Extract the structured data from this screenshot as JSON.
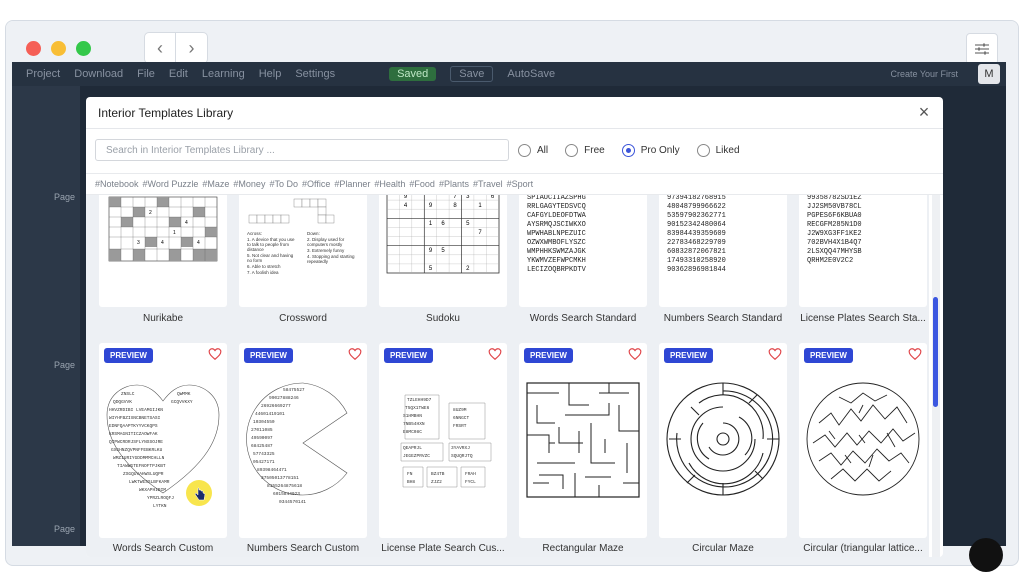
{
  "app_menu": {
    "items": [
      "Project",
      "Download",
      "File",
      "Edit",
      "Learning",
      "Help",
      "Settings"
    ],
    "saved_label": "Saved",
    "save_label": "Save",
    "autosave_label": "AutoSave",
    "create_hint": "Create Your First",
    "avatar_letter": "M"
  },
  "side": {
    "page_label": "Page"
  },
  "modal": {
    "title": "Interior Templates Library",
    "search_placeholder": "Search in Interior Templates Library ...",
    "filters": [
      {
        "label": "All",
        "selected": false
      },
      {
        "label": "Free",
        "selected": false
      },
      {
        "label": "Pro Only",
        "selected": true
      },
      {
        "label": "Liked",
        "selected": false
      }
    ],
    "tags": [
      "#Notebook",
      "#Word Puzzle",
      "#Maze",
      "#Money",
      "#To Do",
      "#Office",
      "#Planner",
      "#Health",
      "#Food",
      "#Plants",
      "#Travel",
      "#Sport"
    ],
    "preview_label": "PREVIEW",
    "row1": [
      "Nurikabe",
      "Crossword",
      "Sudoku",
      "Words Search Standard",
      "Numbers Search Standard",
      "License Plates Search Sta..."
    ],
    "row2": [
      "Words Search Custom",
      "Numbers Search Custom",
      "License Plate Search Cus...",
      "Rectangular Maze",
      "Circular Maze",
      "Circular (triangular lattice..."
    ]
  },
  "colors": {
    "accent": "#2f47d4",
    "heart": "#e0464a",
    "scroll_thumb": "#3c57e0"
  }
}
